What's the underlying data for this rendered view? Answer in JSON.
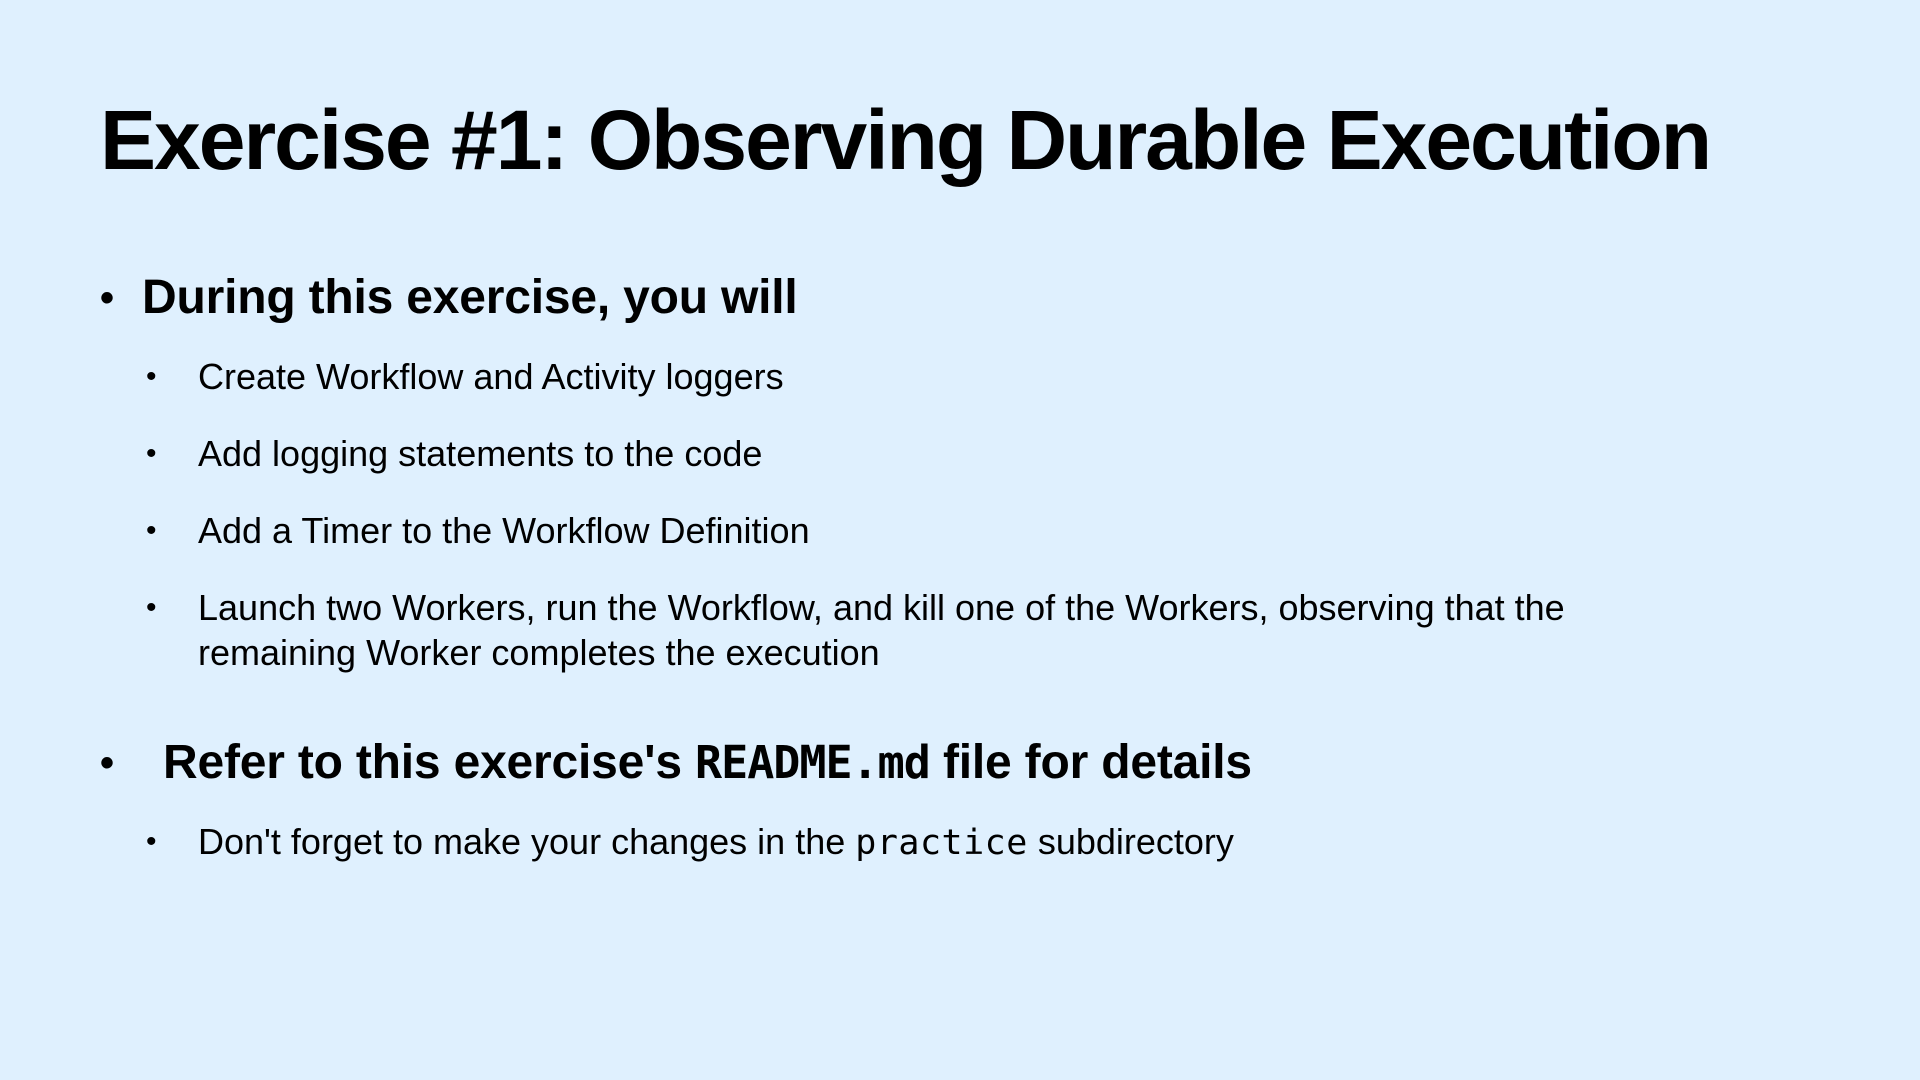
{
  "slide": {
    "title": "Exercise #1: Observing Durable Execution",
    "bullet_glyph": "•",
    "sections": [
      {
        "heading": "During this exercise, you will",
        "items": [
          "Create Workflow and Activity loggers",
          "Add logging statements to the code",
          "Add a Timer to the Workflow Definition",
          "Launch two Workers, run the Workflow, and kill one of the Workers, observing that the remaining Worker completes the execution"
        ]
      },
      {
        "heading_prefix": "Refer to this exercise's ",
        "heading_code": "README.md",
        "heading_suffix": " file for details",
        "items": [
          {
            "prefix": "Don't forget to make your changes in the ",
            "code": "practice",
            "suffix": " subdirectory"
          }
        ]
      }
    ]
  },
  "colors": {
    "background": "#dff0fe",
    "text": "#000000"
  }
}
